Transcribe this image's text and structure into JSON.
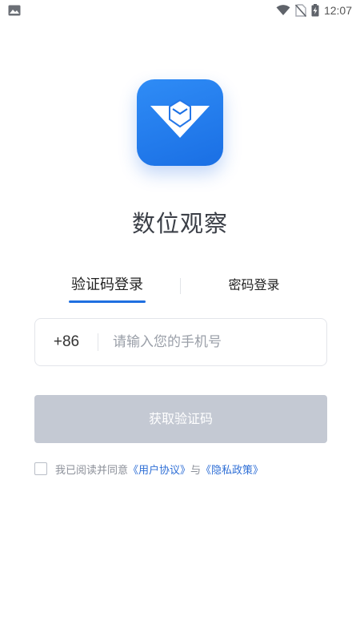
{
  "status_bar": {
    "time": "12:07",
    "left_icon": "image-icon",
    "right_icons": [
      "wifi-icon",
      "no-sim-icon",
      "battery-charging-icon"
    ]
  },
  "app": {
    "name": "数位观察",
    "logo_icon": "app-logo-icon",
    "brand_color": "#1f74e6"
  },
  "tabs": {
    "sms_login": "验证码登录",
    "password_login": "密码登录",
    "active": "sms_login"
  },
  "phone": {
    "country_code": "+86",
    "placeholder": "请输入您的手机号",
    "value": ""
  },
  "get_code_button": "获取验证码",
  "agreement": {
    "prefix": "我已阅读并同意",
    "user_agreement": "《用户协议》",
    "conjunction": "与",
    "privacy_policy": "《隐私政策》",
    "checked": false
  },
  "colors": {
    "accent": "#1f6fe0",
    "button_disabled": "#c4c9d3",
    "link": "#2f6fd6"
  }
}
